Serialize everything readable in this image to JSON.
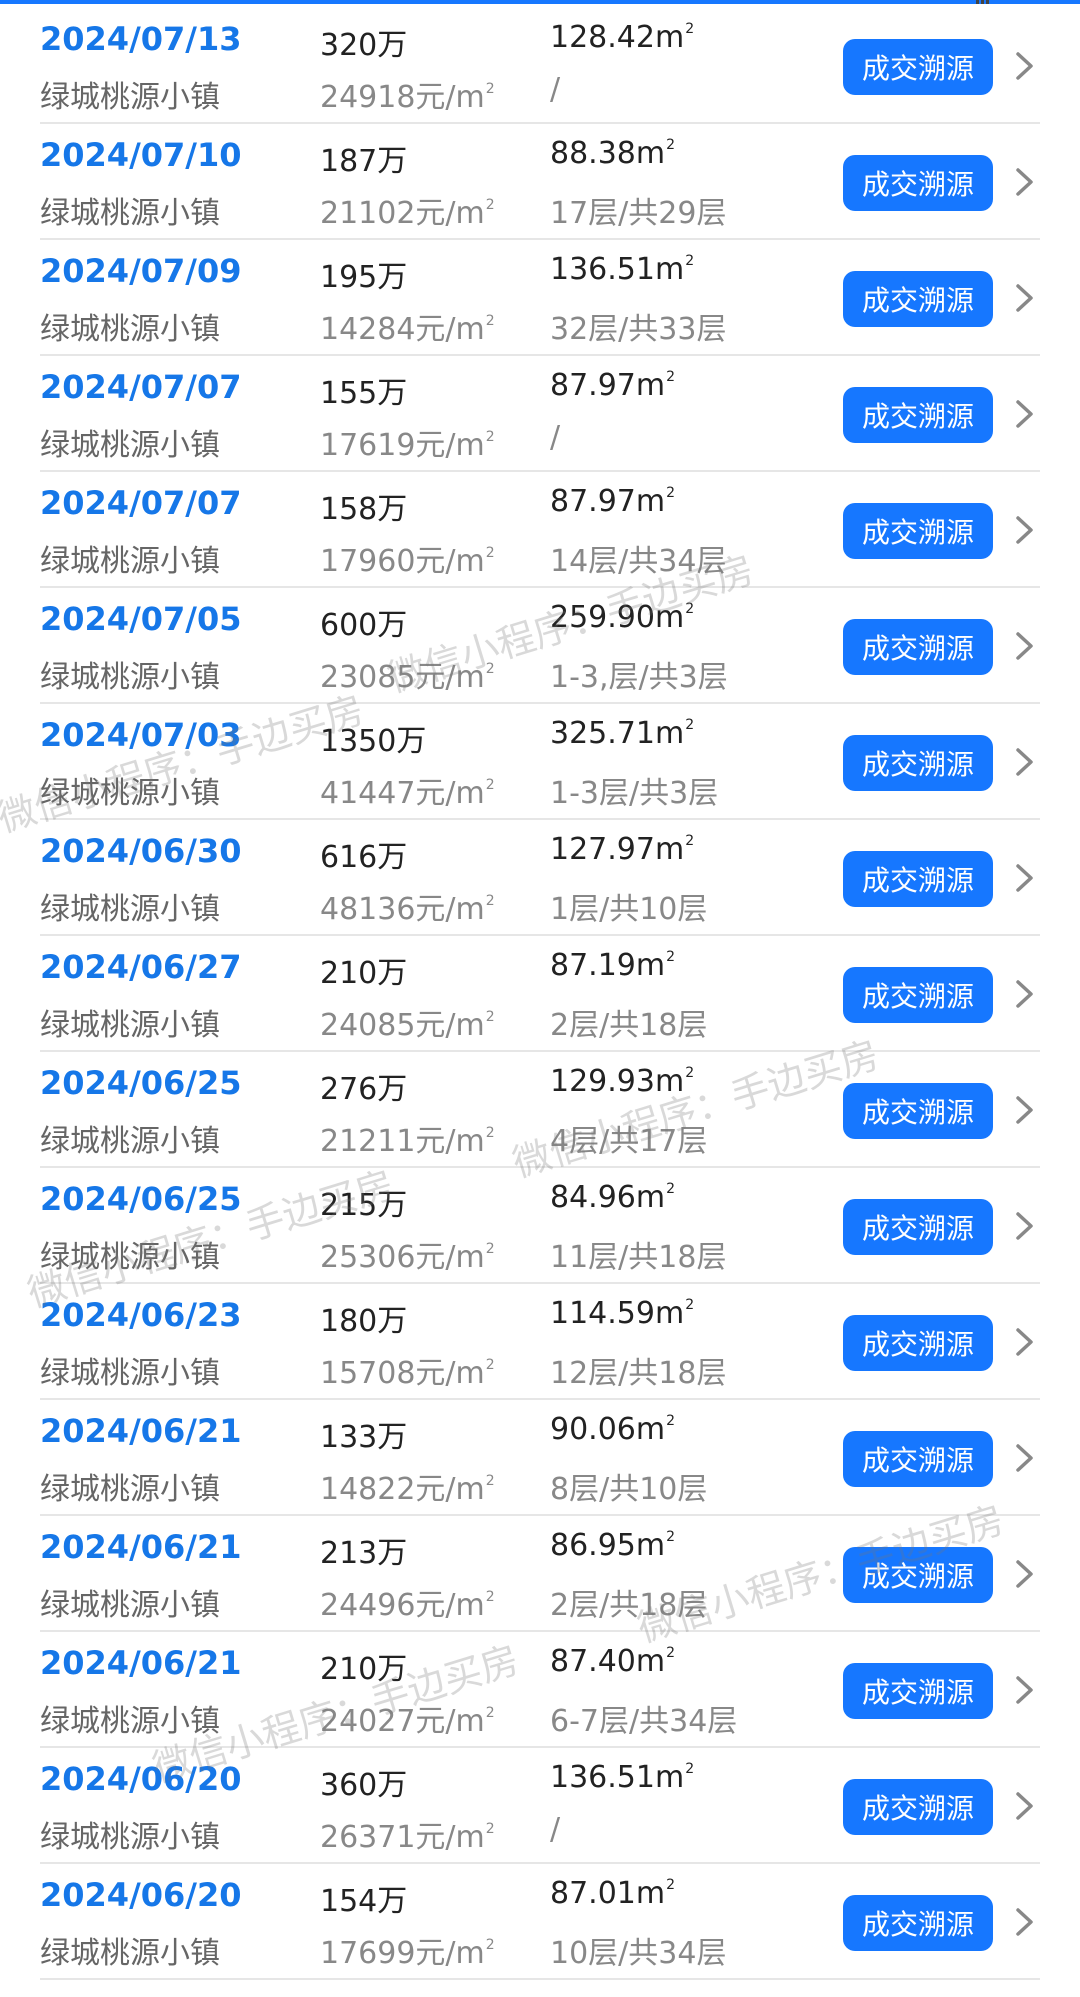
{
  "rows": [
    {
      "date": "2024/07/13",
      "name": "绿城桃源小镇",
      "price": "320万",
      "unit_price": "24918元/m",
      "area": "128.42m",
      "floor": "/",
      "action": "成交溯源"
    },
    {
      "date": "2024/07/10",
      "name": "绿城桃源小镇",
      "price": "187万",
      "unit_price": "21102元/m",
      "area": "88.38m",
      "floor": "17层/共29层",
      "action": "成交溯源"
    },
    {
      "date": "2024/07/09",
      "name": "绿城桃源小镇",
      "price": "195万",
      "unit_price": "14284元/m",
      "area": "136.51m",
      "floor": "32层/共33层",
      "action": "成交溯源"
    },
    {
      "date": "2024/07/07",
      "name": "绿城桃源小镇",
      "price": "155万",
      "unit_price": "17619元/m",
      "area": "87.97m",
      "floor": "/",
      "action": "成交溯源"
    },
    {
      "date": "2024/07/07",
      "name": "绿城桃源小镇",
      "price": "158万",
      "unit_price": "17960元/m",
      "area": "87.97m",
      "floor": "14层/共34层",
      "action": "成交溯源"
    },
    {
      "date": "2024/07/05",
      "name": "绿城桃源小镇",
      "price": "600万",
      "unit_price": "23085元/m",
      "area": "259.90m",
      "floor": "1-3,层/共3层",
      "action": "成交溯源"
    },
    {
      "date": "2024/07/03",
      "name": "绿城桃源小镇",
      "price": "1350万",
      "unit_price": "41447元/m",
      "area": "325.71m",
      "floor": "1-3层/共3层",
      "action": "成交溯源"
    },
    {
      "date": "2024/06/30",
      "name": "绿城桃源小镇",
      "price": "616万",
      "unit_price": "48136元/m",
      "area": "127.97m",
      "floor": "1层/共10层",
      "action": "成交溯源"
    },
    {
      "date": "2024/06/27",
      "name": "绿城桃源小镇",
      "price": "210万",
      "unit_price": "24085元/m",
      "area": "87.19m",
      "floor": "2层/共18层",
      "action": "成交溯源"
    },
    {
      "date": "2024/06/25",
      "name": "绿城桃源小镇",
      "price": "276万",
      "unit_price": "21211元/m",
      "area": "129.93m",
      "floor": "4层/共17层",
      "action": "成交溯源"
    },
    {
      "date": "2024/06/25",
      "name": "绿城桃源小镇",
      "price": "215万",
      "unit_price": "25306元/m",
      "area": "84.96m",
      "floor": "11层/共18层",
      "action": "成交溯源"
    },
    {
      "date": "2024/06/23",
      "name": "绿城桃源小镇",
      "price": "180万",
      "unit_price": "15708元/m",
      "area": "114.59m",
      "floor": "12层/共18层",
      "action": "成交溯源"
    },
    {
      "date": "2024/06/21",
      "name": "绿城桃源小镇",
      "price": "133万",
      "unit_price": "14822元/m",
      "area": "90.06m",
      "floor": "8层/共10层",
      "action": "成交溯源"
    },
    {
      "date": "2024/06/21",
      "name": "绿城桃源小镇",
      "price": "213万",
      "unit_price": "24496元/m",
      "area": "86.95m",
      "floor": "2层/共18层",
      "action": "成交溯源"
    },
    {
      "date": "2024/06/21",
      "name": "绿城桃源小镇",
      "price": "210万",
      "unit_price": "24027元/m",
      "area": "87.40m",
      "floor": "6-7层/共34层",
      "action": "成交溯源"
    },
    {
      "date": "2024/06/20",
      "name": "绿城桃源小镇",
      "price": "360万",
      "unit_price": "26371元/m",
      "area": "136.51m",
      "floor": "/",
      "action": "成交溯源"
    },
    {
      "date": "2024/06/20",
      "name": "绿城桃源小镇",
      "price": "154万",
      "unit_price": "17699元/m",
      "area": "87.01m",
      "floor": "10层/共34层",
      "action": "成交溯源"
    }
  ],
  "superscript": "2",
  "watermark": "微信小程序：手边买房",
  "colors": {
    "accent": "#1677ff",
    "date": "#1677e8"
  },
  "icons": {
    "row_arrow": "chevron-right-icon"
  }
}
